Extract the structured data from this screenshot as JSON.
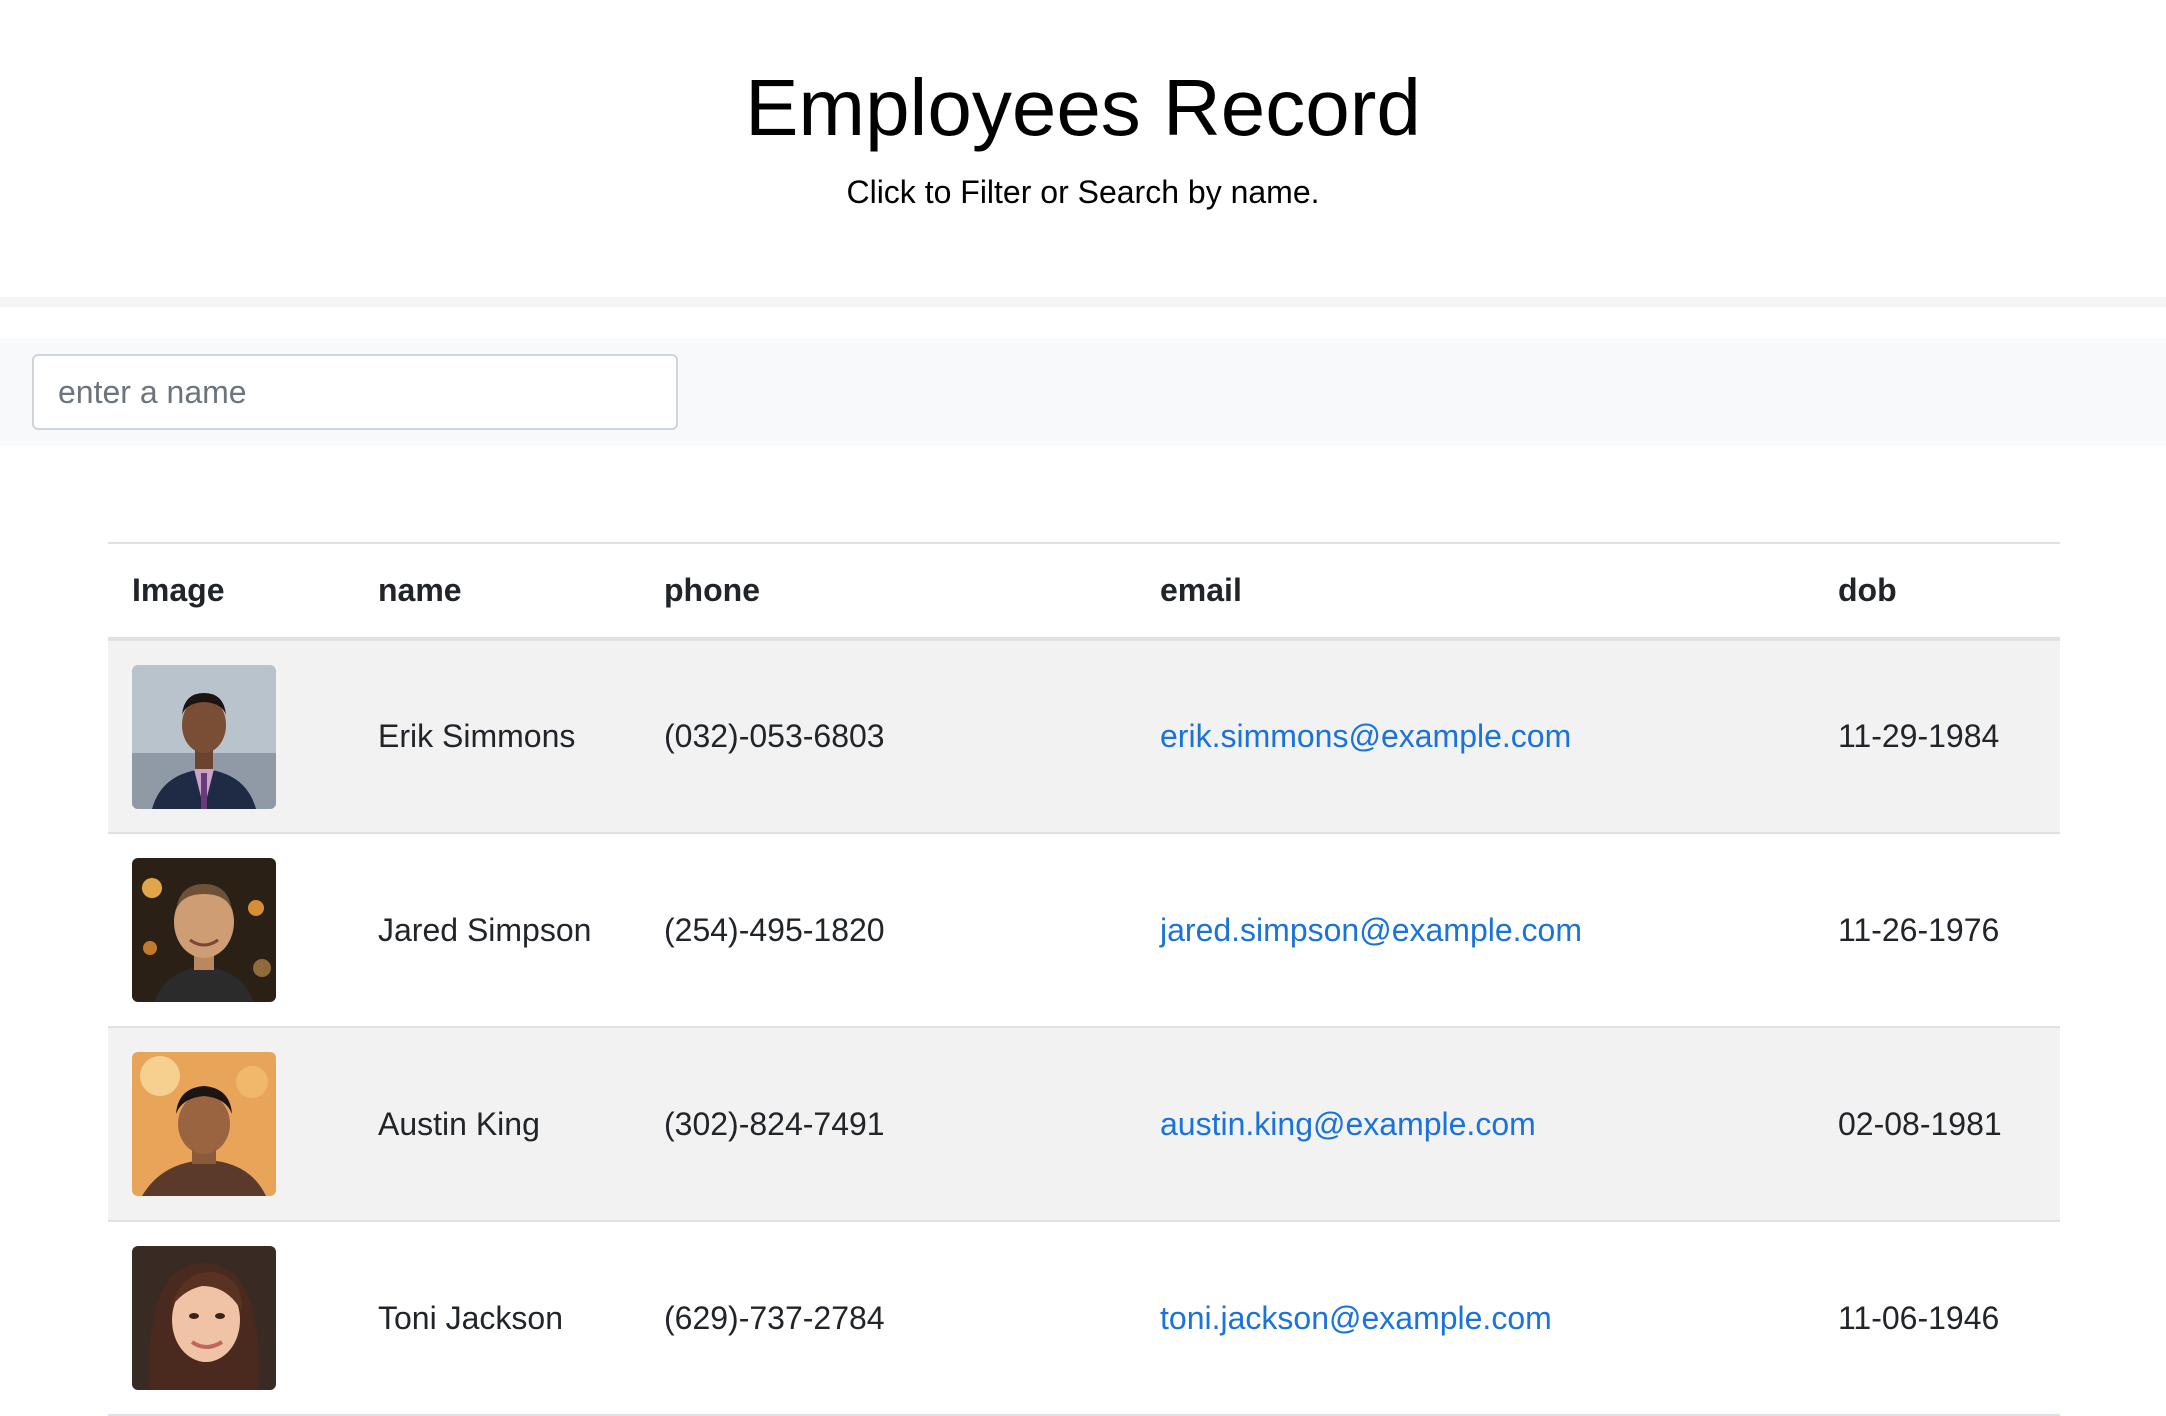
{
  "header": {
    "title": "Employees Record",
    "subtitle": "Click to Filter or Search by name."
  },
  "search": {
    "placeholder": "enter a name",
    "value": ""
  },
  "table": {
    "columns": [
      "Image",
      "name",
      "phone",
      "email",
      "dob"
    ],
    "rows": [
      {
        "name": "Erik Simmons",
        "phone": "(032)-053-6803",
        "email": "erik.simmons@example.com",
        "dob": "11-29-1984",
        "avatar": "photo-man-suit"
      },
      {
        "name": "Jared Simpson",
        "phone": "(254)-495-1820",
        "email": "jared.simpson@example.com",
        "dob": "11-26-1976",
        "avatar": "photo-man-night"
      },
      {
        "name": "Austin King",
        "phone": "(302)-824-7491",
        "email": "austin.king@example.com",
        "dob": "02-08-1981",
        "avatar": "photo-man-warm"
      },
      {
        "name": "Toni Jackson",
        "phone": "(629)-737-2784",
        "email": "toni.jackson@example.com",
        "dob": "11-06-1946",
        "avatar": "photo-woman"
      }
    ]
  },
  "colors": {
    "link": "#1a73d9",
    "stripe": "#f2f2f2",
    "border": "#dee2e6"
  }
}
